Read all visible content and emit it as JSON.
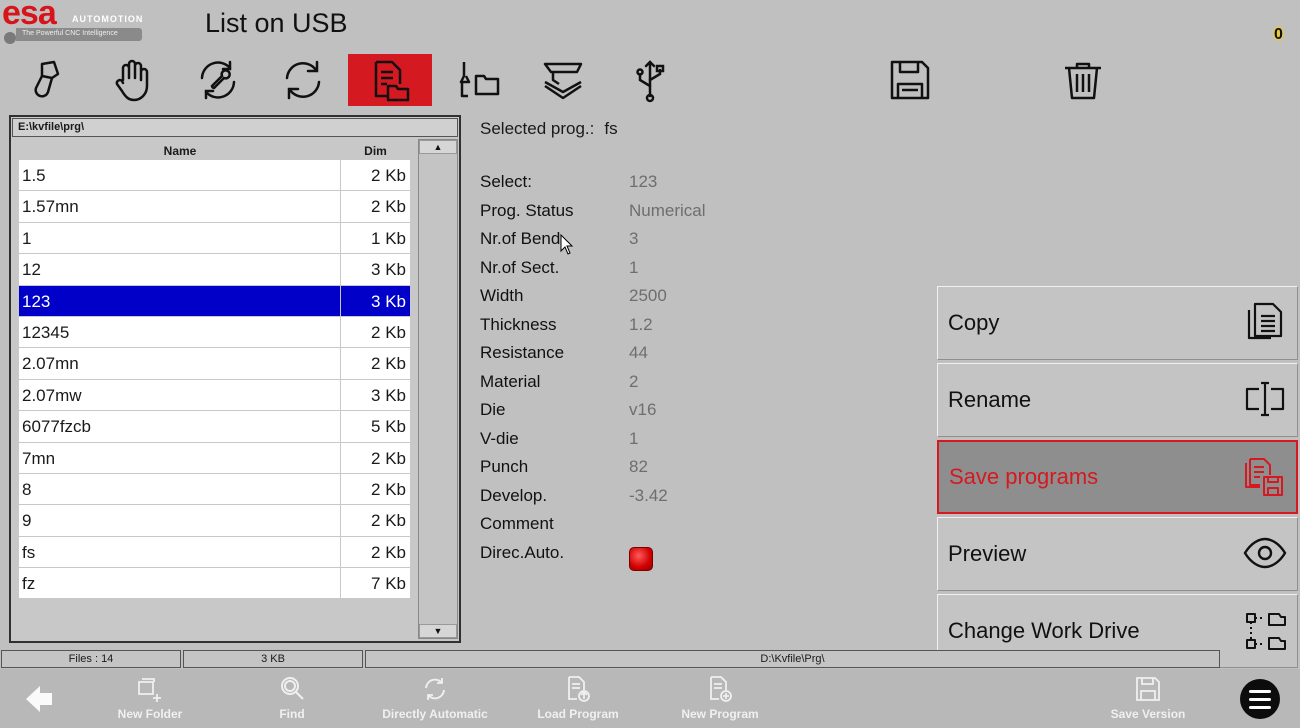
{
  "header": {
    "logo_text": "esa",
    "logo_sub": "AUTOMOTION",
    "logo_tagline": "The Powerful CNC Intelligence",
    "title": "List on USB",
    "counter": "0"
  },
  "toolbar": {
    "items": [
      {
        "icon": "pencil-icon"
      },
      {
        "icon": "hand-icon"
      },
      {
        "icon": "wrench-cycle-icon"
      },
      {
        "icon": "refresh-icon"
      },
      {
        "icon": "file-folder-icon",
        "active": true
      },
      {
        "icon": "tool-folder-icon"
      },
      {
        "icon": "punch-die-icon"
      },
      {
        "icon": "usb-icon"
      },
      {
        "icon": "save-icon"
      },
      {
        "icon": "trash-icon"
      }
    ],
    "active_color": "#d51920"
  },
  "file_list": {
    "path": "E:\\kvfile\\prg\\",
    "col_name": "Name",
    "col_dim": "Dim",
    "rows": [
      {
        "name": "1.5",
        "dim": "2 Kb"
      },
      {
        "name": "1.57mn",
        "dim": "2 Kb"
      },
      {
        "name": "1",
        "dim": "1 Kb"
      },
      {
        "name": "12",
        "dim": "3 Kb"
      },
      {
        "name": "123",
        "dim": "3 Kb",
        "selected": true
      },
      {
        "name": "12345",
        "dim": "2 Kb"
      },
      {
        "name": "2.07mn",
        "dim": "2 Kb"
      },
      {
        "name": "2.07mw",
        "dim": "3 Kb"
      },
      {
        "name": "6077fzcb",
        "dim": "5 Kb"
      },
      {
        "name": "7mn",
        "dim": "2 Kb"
      },
      {
        "name": "8",
        "dim": "2 Kb"
      },
      {
        "name": "9",
        "dim": "2 Kb"
      },
      {
        "name": "fs",
        "dim": "2 Kb"
      },
      {
        "name": "fz",
        "dim": "7 Kb"
      }
    ],
    "selection_color": "#0000c8"
  },
  "details": {
    "selected_prog_label": "Selected prog.:",
    "selected_prog_value": "fs",
    "fields": [
      {
        "label": "Select:",
        "value": "123"
      },
      {
        "label": "Prog. Status",
        "value": "Numerical"
      },
      {
        "label": "Nr.of Bend",
        "value": "3"
      },
      {
        "label": "Nr.of Sect.",
        "value": "1"
      },
      {
        "label": "Width",
        "value": "2500"
      },
      {
        "label": "Thickness",
        "value": "1.2"
      },
      {
        "label": "Resistance",
        "value": "44"
      },
      {
        "label": "Material",
        "value": "2"
      },
      {
        "label": "Die",
        "value": "v16"
      },
      {
        "label": "V-die",
        "value": "1"
      },
      {
        "label": "Punch",
        "value": "82"
      },
      {
        "label": "Develop.",
        "value": "-3.42"
      },
      {
        "label": "Comment",
        "value": ""
      },
      {
        "label": "Direc.Auto.",
        "value": ""
      }
    ],
    "direc_auto_led_color": "#d00000"
  },
  "actions": [
    {
      "label": "Copy",
      "icon": "copy-icon"
    },
    {
      "label": "Rename",
      "icon": "rename-icon"
    },
    {
      "label": "Save programs",
      "icon": "save-programs-icon",
      "active": true
    },
    {
      "label": "Preview",
      "icon": "eye-icon"
    },
    {
      "label": "Change Work Drive",
      "icon": "drive-tree-icon"
    }
  ],
  "status_bar": {
    "files": "Files : 14",
    "size": "3 KB",
    "path": "D:\\Kvfile\\Prg\\"
  },
  "bottom_bar": {
    "new_folder": "New Folder",
    "find": "Find",
    "directly_automatic": "Directly Automatic",
    "load_program": "Load Program",
    "new_program": "New Program",
    "save_version": "Save Version"
  }
}
